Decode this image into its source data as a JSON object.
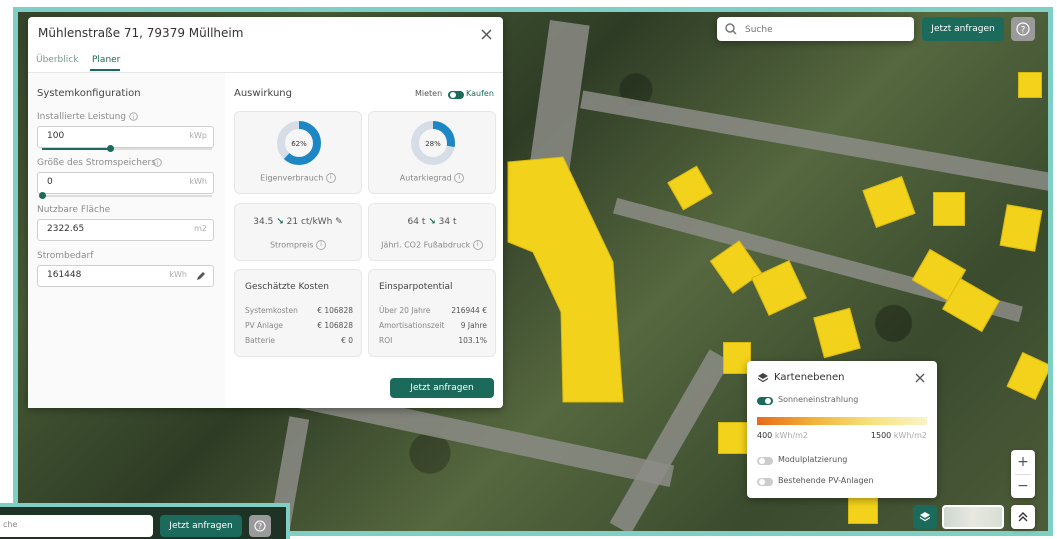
{
  "colors": {
    "accent": "#1b6a5b",
    "frame": "#7fcfc4",
    "roof": "#f2d21b"
  },
  "search": {
    "placeholder": "Suche",
    "cta": "Jetzt anfragen",
    "help_icon": "question-icon"
  },
  "panel": {
    "address": "Mühlenstraße 71, 79379 Müllheim",
    "close_icon": "close-icon",
    "tabs": [
      {
        "label": "Überblick",
        "active": false
      },
      {
        "label": "Planer",
        "active": true
      }
    ],
    "config": {
      "heading": "Systemkonfiguration",
      "installed_power": {
        "label": "Installierte Leistung",
        "value": "100",
        "unit": "kWp",
        "slider_fraction": 0.4
      },
      "storage": {
        "label": "Größe des Stromspeichers",
        "value": "0",
        "unit": "kWh",
        "slider_fraction": 0.0
      },
      "area": {
        "label": "Nutzbare Fläche",
        "value": "2322.65",
        "unit": "m2"
      },
      "demand": {
        "label": "Strombedarf",
        "value": "161448",
        "unit": "kWh"
      }
    },
    "impact": {
      "heading": "Auswirkung",
      "toggle_left": "Mieten",
      "toggle_right": "Kaufen",
      "self_consumption": {
        "percent": 62,
        "label": "62%",
        "caption": "Eigenverbrauch"
      },
      "autarky": {
        "percent": 28,
        "label": "28%",
        "caption": "Autarkiegrad"
      },
      "price": {
        "from": "34.5",
        "to": "21 ct/kWh",
        "caption": "Strompreis"
      },
      "co2": {
        "from": "64 t",
        "to": "34 t",
        "caption": "Jährl. CO2 Fußabdruck"
      },
      "costs": {
        "heading": "Geschätzte Kosten",
        "rows": [
          {
            "label": "Systemkosten",
            "value": "€ 106828"
          },
          {
            "label": "PV Anlage",
            "value": "€ 106828"
          },
          {
            "label": "Batterie",
            "value": "€ 0"
          }
        ]
      },
      "savings": {
        "heading": "Einsparpotential",
        "rows": [
          {
            "label": "Über 20 Jahre",
            "value": "216944 €"
          },
          {
            "label": "Amortisationszeit",
            "value": "9 Jahre"
          },
          {
            "label": "ROI",
            "value": "103.1%"
          }
        ]
      },
      "cta": "Jetzt anfragen"
    }
  },
  "layers": {
    "title": "Kartenebenen",
    "items": [
      {
        "label": "Sonneneinstrahlung",
        "on": true
      },
      {
        "label": "Modulplatzierung",
        "on": false
      },
      {
        "label": "Bestehende PV-Anlagen",
        "on": false
      }
    ],
    "legend_min": "400",
    "legend_max": "1500",
    "legend_unit": "kWh/m2"
  },
  "map_controls": {
    "zoom_in": "+",
    "zoom_out": "−"
  },
  "inset": {
    "placeholder": "che",
    "cta": "Jetzt anfragen"
  }
}
